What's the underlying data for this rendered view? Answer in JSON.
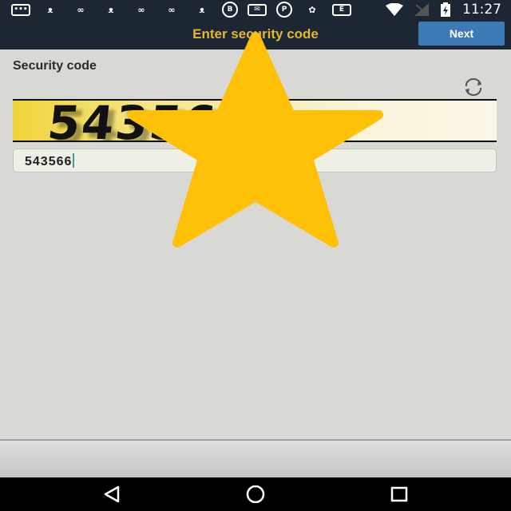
{
  "status_bar": {
    "time": "11:27",
    "left_icons": [
      "chat-bubble-icon",
      "cat-face-icon",
      "infinity-icon",
      "cat-face-icon",
      "infinity-icon",
      "infinity-icon",
      "cat-face-icon",
      "b-circle-icon",
      "mail-icon",
      "pinterest-icon",
      "cluster-icon",
      "e-box-icon"
    ],
    "right_icons": [
      "wifi-icon",
      "no-signal-icon",
      "battery-charging-icon"
    ]
  },
  "header": {
    "title": "Enter security code",
    "next_label": "Next"
  },
  "form": {
    "label": "Security code",
    "captcha_text": "543566",
    "input_value": "543566"
  },
  "colors": {
    "header_bg": "#1c2733",
    "title": "#e6b531",
    "next_button": "#3d7ab8",
    "star": "#ffc107"
  }
}
